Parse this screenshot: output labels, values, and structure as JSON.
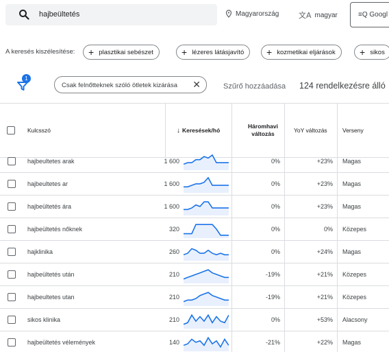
{
  "topbar": {
    "search_value": "hajbeültetés",
    "location": "Magyarország",
    "language": "magyar",
    "google_button": "Googl"
  },
  "refine": {
    "label": "A keresés kiszélesítése:",
    "chips": [
      "plasztikai sebészet",
      "lézeres látásjavító",
      "kozmetikai eljárások",
      "sikos"
    ]
  },
  "filters": {
    "badge_count": "1",
    "active_filter": "Csak felnőtteknek szóló ötletek kizárása",
    "add_filter": "Szűrő hozzáadása",
    "available": "124 rendelkezésre álló"
  },
  "table": {
    "headers": {
      "keyword": "Kulcsszó",
      "searches": "Keresések/hó",
      "three_month": "Háromhavi változás",
      "yoy": "YoY változás",
      "competition": "Verseny"
    },
    "rows": [
      {
        "keyword": "hajbeultetes arak",
        "volume": "1 600",
        "three_month": "0%",
        "yoy": "+23%",
        "competition": "Magas",
        "trend": [
          3,
          4,
          4,
          6,
          6,
          8,
          7,
          9,
          4,
          4,
          4,
          4
        ]
      },
      {
        "keyword": "hajbeultetes ar",
        "volume": "1 600",
        "three_month": "0%",
        "yoy": "+23%",
        "competition": "Magas",
        "trend": [
          3,
          3,
          4,
          5,
          5,
          6,
          9,
          4,
          4,
          4,
          4,
          4
        ]
      },
      {
        "keyword": "hajbeültetés ára",
        "volume": "1 600",
        "three_month": "0%",
        "yoy": "+23%",
        "competition": "Magas",
        "trend": [
          3,
          3,
          4,
          6,
          5,
          8,
          8,
          4,
          4,
          4,
          4,
          4
        ]
      },
      {
        "keyword": "hajbeültetés nőknek",
        "volume": "320",
        "three_month": "0%",
        "yoy": "0%",
        "competition": "Közepes",
        "trend": [
          2,
          2,
          2,
          8,
          8,
          8,
          8,
          8,
          5,
          1,
          1,
          1
        ]
      },
      {
        "keyword": "hajklinika",
        "volume": "260",
        "three_month": "0%",
        "yoy": "+24%",
        "competition": "Magas",
        "trend": [
          3,
          4,
          7,
          6,
          4,
          4,
          6,
          4,
          3,
          4,
          3,
          3
        ]
      },
      {
        "keyword": "hajbeültetés után",
        "volume": "210",
        "three_month": "-19%",
        "yoy": "+21%",
        "competition": "Közepes",
        "trend": [
          2,
          3,
          4,
          5,
          6,
          7,
          8,
          6,
          5,
          4,
          3,
          3
        ]
      },
      {
        "keyword": "hajbeultetes utan",
        "volume": "210",
        "three_month": "-19%",
        "yoy": "+21%",
        "competition": "Közepes",
        "trend": [
          2,
          3,
          3,
          4,
          6,
          7,
          8,
          6,
          5,
          4,
          3,
          3
        ]
      },
      {
        "keyword": "sikos klinika",
        "volume": "210",
        "three_month": "0%",
        "yoy": "+53%",
        "competition": "Alacsony",
        "trend": [
          2,
          3,
          8,
          4,
          7,
          4,
          8,
          3,
          7,
          4,
          3,
          8
        ]
      },
      {
        "keyword": "hajbeültetés vélemények",
        "volume": "140",
        "three_month": "-21%",
        "yoy": "+22%",
        "competition": "Magas",
        "trend": [
          3,
          4,
          7,
          5,
          6,
          3,
          8,
          4,
          6,
          2,
          7,
          3
        ]
      }
    ]
  },
  "colors": {
    "accent": "#1a73e8",
    "spark_fill": "#e8f0fe"
  }
}
